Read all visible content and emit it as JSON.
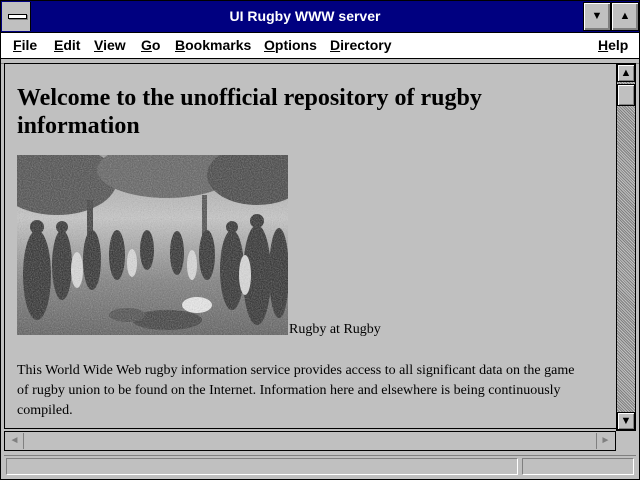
{
  "window": {
    "title": "UI Rugby WWW server"
  },
  "menu": {
    "file": "File",
    "edit": "Edit",
    "view": "View",
    "go": "Go",
    "bookmarks": "Bookmarks",
    "options": "Options",
    "directory": "Directory",
    "help": "Help"
  },
  "page": {
    "heading": "Welcome to the unofficial repository of rugby information",
    "image_caption": "Rugby at Rugby",
    "paragraph": "This World Wide Web rugby information service provides access to all significant data on the game of rugby union to be found on the Internet. Information here and elsewhere is being continuously compiled."
  },
  "icons": {
    "system_menu": "system-menu-icon",
    "minimize": "minimize-icon",
    "maximize": "maximize-icon",
    "scroll_up": "arrow-up-icon",
    "scroll_down": "arrow-down-icon",
    "scroll_left": "arrow-left-icon",
    "scroll_right": "arrow-right-icon"
  },
  "colors": {
    "titlebar": "#000080",
    "background": "#c0c0c0"
  }
}
